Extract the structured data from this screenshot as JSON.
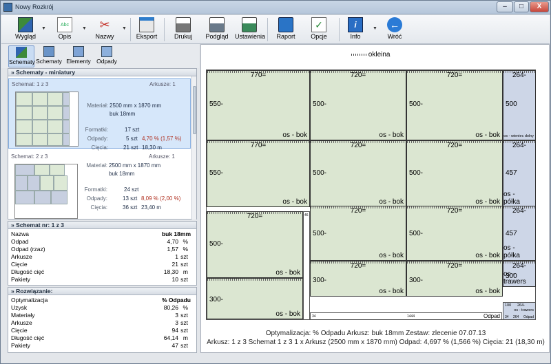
{
  "window": {
    "title": "Nowy Rozkrój",
    "btn_min": "–",
    "btn_max": "□",
    "btn_close": "X"
  },
  "toolbar": {
    "wyglad": "Wygląd",
    "opis": "Opis",
    "nazwy": "Nazwy",
    "eksport": "Eksport",
    "drukuj": "Drukuj",
    "podglad": "Podgląd",
    "ustawienia": "Ustawienia",
    "raport": "Raport",
    "opcje": "Opcje",
    "info": "Info",
    "wroc": "Wróć",
    "dropdown": "▼"
  },
  "subtoolbar": {
    "schematy1": "Schematy",
    "schematy2": "Schematy",
    "elementy": "Elementy",
    "odpady": "Odpady"
  },
  "miniatures": {
    "header": "»  Schematy - miniatury",
    "items": [
      {
        "schemat_label": "Schemat:",
        "schemat": "1 z 3",
        "arkusze_label": "Arkusze:",
        "arkusze": "1",
        "material_label": "Materiał:",
        "material": "2500 mm x 1870 mm",
        "material2": "buk 18mm",
        "formatki_label": "Formatki:",
        "formatki": "17 szt",
        "odpady_label": "Odpady:",
        "odpady_szt": "5 szt",
        "odpady_pct": "4,70 % (1,57 %)",
        "ciecia_label": "Cięcia:",
        "ciecia_szt": "21 szt",
        "ciecia_m": "18,30 m"
      },
      {
        "schemat_label": "Schemat:",
        "schemat": "2 z 3",
        "arkusze_label": "Arkusze:",
        "arkusze": "1",
        "material_label": "Materiał:",
        "material": "2500 mm x 1870 mm",
        "material2": "buk 18mm",
        "formatki_label": "Formatki:",
        "formatki": "24 szt",
        "odpady_label": "Odpady:",
        "odpady_szt": "13 szt",
        "odpady_pct": "8,09 % (2,00 %)",
        "ciecia_label": "Cięcia:",
        "ciecia_szt": "36 szt",
        "ciecia_m": "23,40 m"
      }
    ]
  },
  "schemat": {
    "header": "»  Schemat nr: 1 z 3",
    "rows": [
      {
        "k": "Nazwa",
        "v": "buk 18mm",
        "u": ""
      },
      {
        "k": "Odpad",
        "v": "4,70",
        "u": "%"
      },
      {
        "k": "Odpad (rzaz)",
        "v": "1,57",
        "u": "%"
      },
      {
        "k": "Arkusze",
        "v": "1",
        "u": "szt"
      },
      {
        "k": "Cięcie",
        "v": "21",
        "u": "szt"
      },
      {
        "k": "Długość cięć",
        "v": "18,30",
        "u": "m"
      },
      {
        "k": "Pakiety",
        "v": "10",
        "u": "szt"
      }
    ]
  },
  "rozwiazanie": {
    "header": "»  Rozwiązanie:",
    "rows": [
      {
        "k": "Optymalizacja",
        "v": "% Odpadu",
        "u": ""
      },
      {
        "k": "Uzysk",
        "v": "80,26",
        "u": "%"
      },
      {
        "k": "Materiały",
        "v": "3",
        "u": "szt"
      },
      {
        "k": "Arkusze",
        "v": "3",
        "u": "szt"
      },
      {
        "k": "Cięcie",
        "v": "94",
        "u": "szt"
      },
      {
        "k": "Długość cięć",
        "v": "64,14",
        "u": "m"
      },
      {
        "k": "Pakiety",
        "v": "47",
        "u": "szt"
      }
    ]
  },
  "sheet": {
    "legend": "okleina",
    "pieces": [
      {
        "w": "770=",
        "h": "550-",
        "n": "os - bok"
      },
      {
        "w": "720=",
        "h": "500-",
        "n": "os - bok"
      },
      {
        "w": "720=",
        "h": "500-",
        "n": "os - bok"
      },
      {
        "w": "264-",
        "h": "500",
        "n": "os - wieniec dolny"
      },
      {
        "w": "770=",
        "h": "550-",
        "n": "os - bok"
      },
      {
        "w": "720=",
        "h": "500-",
        "n": "os - bok"
      },
      {
        "w": "720=",
        "h": "500-",
        "n": "os - bok"
      },
      {
        "w": "264-",
        "h": "457",
        "n": "os - półka"
      },
      {
        "w": "720=",
        "h": "500-",
        "n": "os - bok"
      },
      {
        "w": "720=",
        "h": "500-",
        "n": "os - bok"
      },
      {
        "w": "720=",
        "h": "500-",
        "n": "os - bok"
      },
      {
        "w": "264-",
        "h": "457",
        "n": "os - półka"
      },
      {
        "w": "",
        "h": "300-",
        "n": "os - bok"
      },
      {
        "w": "720=",
        "h": "300-",
        "n": "os - bok"
      },
      {
        "w": "720=",
        "h": "300-",
        "n": "os - bok"
      },
      {
        "w": "264-",
        "h": "300",
        "n": "os - trawers"
      }
    ],
    "small_label_1": "100",
    "small_label_2": "264-",
    "small_label_3": "os - trawers",
    "strip_label_v": "46",
    "strip_bottom_1": "34",
    "strip_bottom_2": "1444",
    "strip_bottom_3": "Odpad",
    "strip_bottom_4": "34",
    "strip_bottom_5": "264",
    "strip_bottom_6": "Odpad"
  },
  "footer": {
    "line1": "Optymalizacja: % Odpadu  Arkusz: buk 18mm  Zestaw: zlecenie 07.07.13",
    "line2": "Arkusz: 1  z 3  Schemat 1 z 3  1 x Arkusz (2500 mm x 1870 mm)  Odpad: 4,697 % (1,566 %)  Cięcia: 21 (18,30 m)"
  }
}
